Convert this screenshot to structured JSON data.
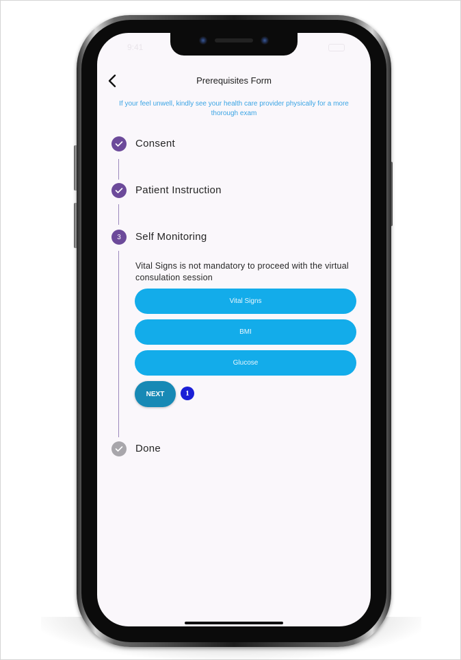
{
  "header": {
    "title": "Prerequisites Form",
    "back_icon": "chevron-left-icon"
  },
  "notice": "If your feel unwell, kindly see your health care provider physically for a more thorough exam",
  "steps": [
    {
      "label": "Consent",
      "state": "completed",
      "icon": "check-icon"
    },
    {
      "label": "Patient Instruction",
      "state": "completed",
      "icon": "check-icon"
    },
    {
      "label": "Self Monitoring",
      "state": "active",
      "number": "3"
    },
    {
      "label": "Done",
      "state": "pending",
      "icon": "check-icon"
    }
  ],
  "self_monitoring": {
    "description": "Vital Signs is not mandatory to proceed with the virtual consulation session",
    "buttons": [
      "Vital Signs",
      "BMI",
      "Glucose"
    ],
    "next_label": "NEXT"
  },
  "annotation_marker": "1",
  "colors": {
    "primary_purple": "#6c4a9a",
    "pill_blue": "#13acea",
    "next_blue": "#1789b5",
    "notice_blue": "#3aa4e4",
    "pending_gray": "#a8a6ab",
    "marker_blue": "#1b1fd6",
    "screen_bg": "#faf7fb"
  }
}
